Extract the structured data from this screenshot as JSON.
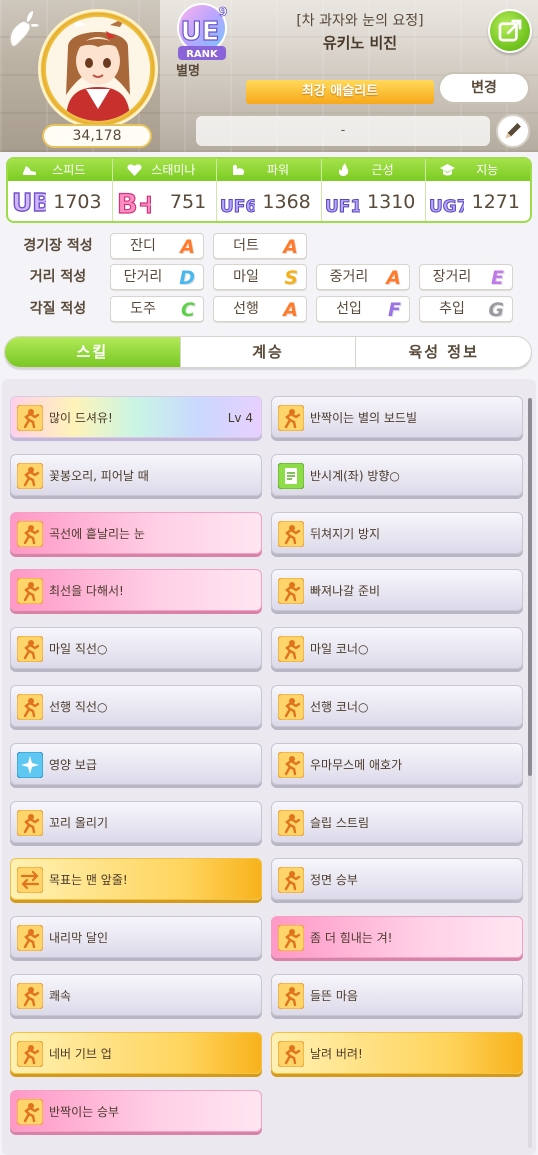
{
  "profile": {
    "fans": "34,178",
    "rank_label": "UE",
    "rank_level": "9",
    "rank_word": "RANK",
    "epithet_heading": "별명",
    "epithet": "[차 과자와 눈의 요정]",
    "name": "유키노 비진",
    "title_ribbon": "최강 애슬리트",
    "change_label": "변경",
    "comment": "-"
  },
  "stats": [
    {
      "label": "스피드",
      "icon": "shoe-icon",
      "grade": "UB",
      "value": "1703"
    },
    {
      "label": "스태미나",
      "icon": "heart-icon",
      "grade": "B+",
      "value": "751"
    },
    {
      "label": "파워",
      "icon": "muscle-icon",
      "grade": "UF6",
      "value": "1368"
    },
    {
      "label": "근성",
      "icon": "flame-icon",
      "grade": "UF1",
      "value": "1310"
    },
    {
      "label": "지능",
      "icon": "graduation-cap-icon",
      "grade": "UG7",
      "value": "1271"
    }
  ],
  "aptitude": {
    "track": {
      "label": "경기장 적성",
      "items": [
        {
          "name": "잔디",
          "grade": "A"
        },
        {
          "name": "더트",
          "grade": "A"
        }
      ]
    },
    "distance": {
      "label": "거리 적성",
      "items": [
        {
          "name": "단거리",
          "grade": "D"
        },
        {
          "name": "마일",
          "grade": "S"
        },
        {
          "name": "중거리",
          "grade": "A"
        },
        {
          "name": "장거리",
          "grade": "E"
        }
      ]
    },
    "style": {
      "label": "각질 적성",
      "items": [
        {
          "name": "도주",
          "grade": "C"
        },
        {
          "name": "선행",
          "grade": "A"
        },
        {
          "name": "선입",
          "grade": "F"
        },
        {
          "name": "추입",
          "grade": "G"
        }
      ]
    }
  },
  "grade_colors": {
    "A": "#ff7a2a",
    "S": "#f2b01a",
    "B": "#ff5aa0",
    "C": "#5ed04a",
    "D": "#4ab8ee",
    "E": "#c07be8",
    "F": "#9b72e8",
    "G": "#9a9aa0"
  },
  "tabs": [
    {
      "label": "스킬",
      "active": true
    },
    {
      "label": "계승",
      "active": false
    },
    {
      "label": "육성 정보",
      "active": false
    }
  ],
  "skills": [
    {
      "name": "많이 드셔유!",
      "level": "Lv 4",
      "style": "rainbow",
      "icon": "running-figure-icon"
    },
    {
      "name": "반짝이는 별의 보드빌",
      "level": "",
      "style": "plain",
      "icon": "running-figure-icon"
    },
    {
      "name": "꽃봉오리, 피어날 때",
      "level": "",
      "style": "plain",
      "icon": "running-figure-icon"
    },
    {
      "name": "반시계(좌) 방향○",
      "level": "",
      "style": "plain",
      "icon": "green-document-icon"
    },
    {
      "name": "곡선에 흩날리는 눈",
      "level": "",
      "style": "pink",
      "icon": "running-figure-icon"
    },
    {
      "name": "뒤쳐지기 방지",
      "level": "",
      "style": "plain",
      "icon": "running-figure-icon"
    },
    {
      "name": "최선을 다해서!",
      "level": "",
      "style": "pink",
      "icon": "running-figure-icon"
    },
    {
      "name": "빠져나갈 준비",
      "level": "",
      "style": "plain",
      "icon": "running-figure-icon"
    },
    {
      "name": "마일 직선○",
      "level": "",
      "style": "plain",
      "icon": "running-figure-icon"
    },
    {
      "name": "마일 코너○",
      "level": "",
      "style": "plain",
      "icon": "running-figure-icon"
    },
    {
      "name": "선행 직선○",
      "level": "",
      "style": "plain",
      "icon": "running-figure-icon"
    },
    {
      "name": "선행 코너○",
      "level": "",
      "style": "plain",
      "icon": "running-figure-icon"
    },
    {
      "name": "영양 보급",
      "level": "",
      "style": "plain",
      "icon": "blue-sparkle-icon"
    },
    {
      "name": "우마무스메 애호가",
      "level": "",
      "style": "plain",
      "icon": "running-figure-icon"
    },
    {
      "name": "꼬리 올리기",
      "level": "",
      "style": "plain",
      "icon": "running-figure-icon"
    },
    {
      "name": "슬립 스트림",
      "level": "",
      "style": "plain",
      "icon": "running-figure-icon"
    },
    {
      "name": "목표는 맨 앞줄!",
      "level": "",
      "style": "gold",
      "icon": "arrows-icon"
    },
    {
      "name": "정면 승부",
      "level": "",
      "style": "plain",
      "icon": "running-figure-icon"
    },
    {
      "name": "내리막 달인",
      "level": "",
      "style": "plain",
      "icon": "running-figure-icon"
    },
    {
      "name": "좀 더 힘내는 겨!",
      "level": "",
      "style": "pink",
      "icon": "running-figure-icon"
    },
    {
      "name": "쾌속",
      "level": "",
      "style": "plain",
      "icon": "running-figure-icon"
    },
    {
      "name": "들뜬 마음",
      "level": "",
      "style": "plain",
      "icon": "running-figure-icon"
    },
    {
      "name": "네버 기브 업",
      "level": "",
      "style": "gold",
      "icon": "running-figure-icon"
    },
    {
      "name": "날려 버려!",
      "level": "",
      "style": "gold",
      "icon": "running-figure-icon"
    },
    {
      "name": "반짝이는 승부",
      "level": "",
      "style": "pink",
      "icon": "running-figure-icon"
    }
  ]
}
